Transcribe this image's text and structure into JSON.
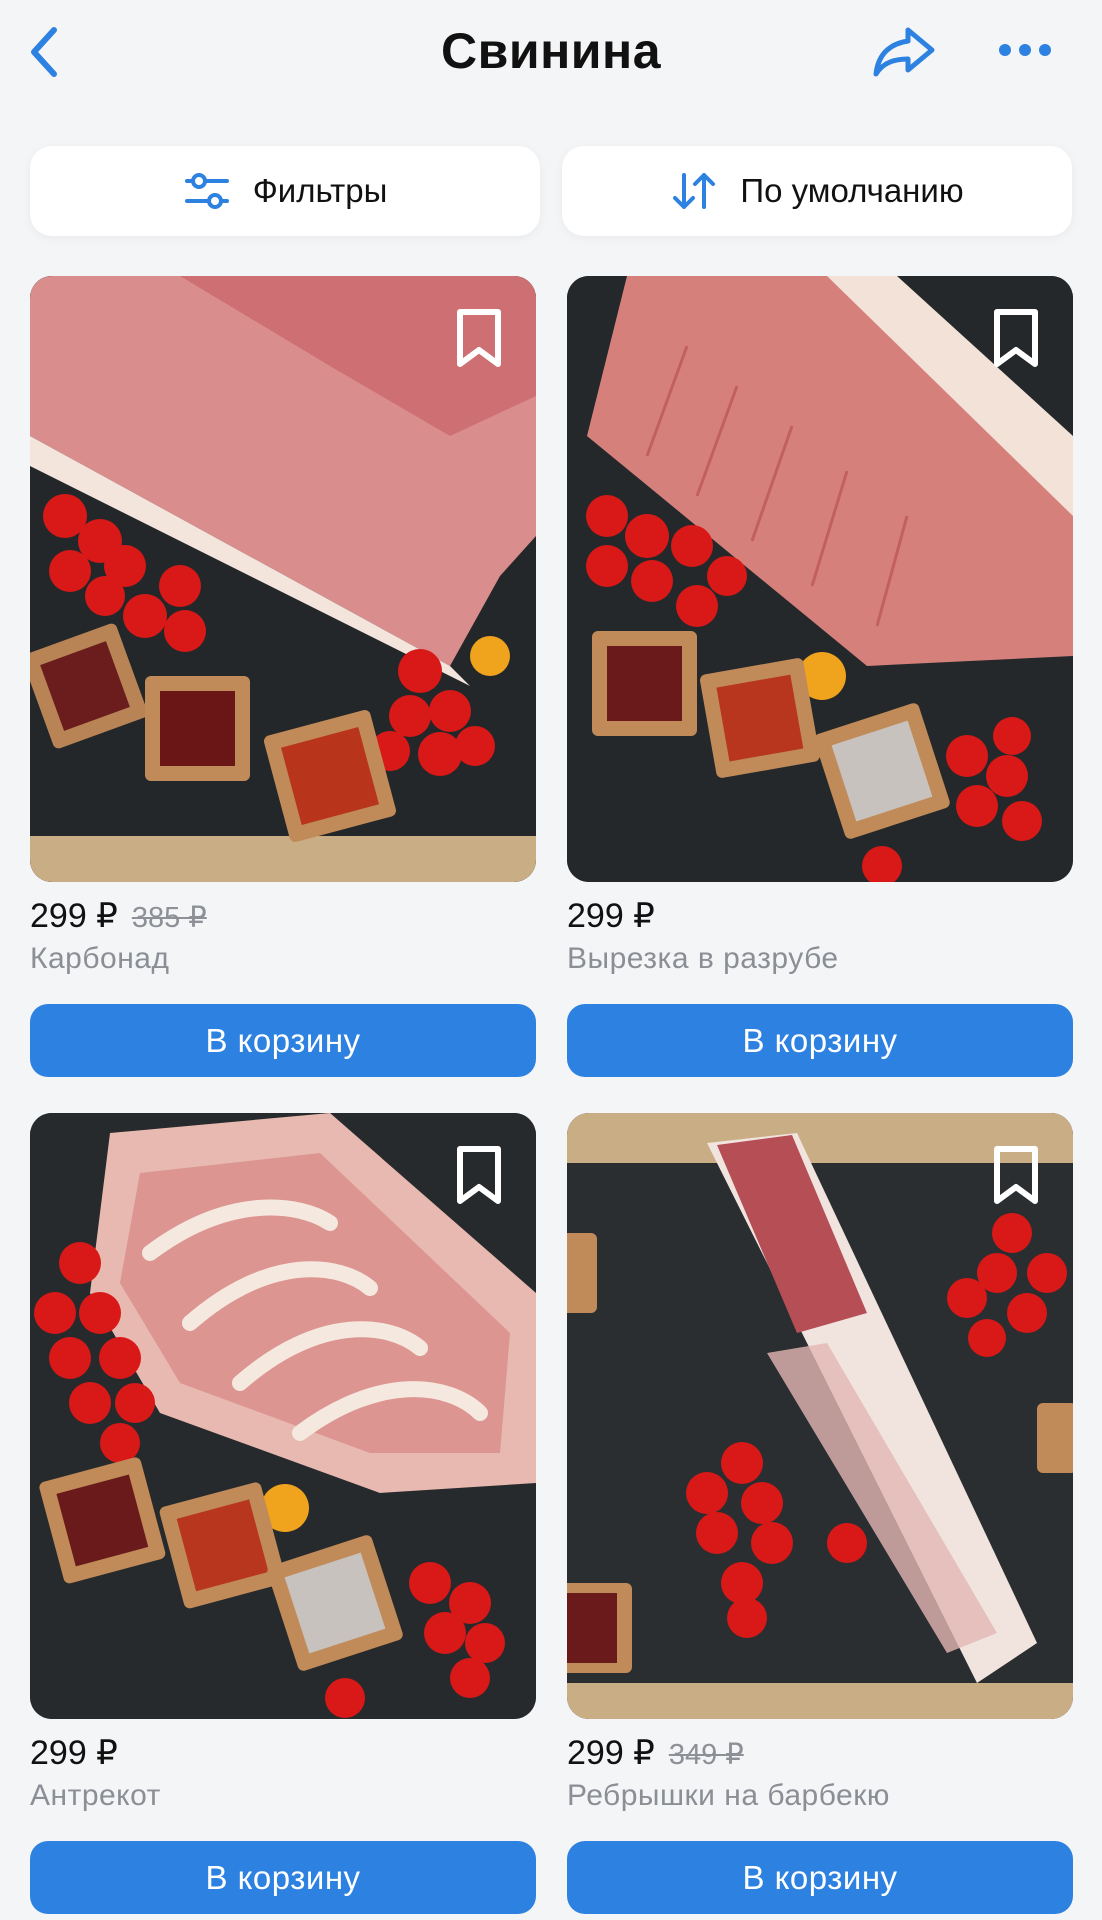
{
  "header": {
    "title": "Свинина",
    "back_icon": "chevron-left-icon",
    "share_icon": "share-arrow-icon",
    "more_icon": "more-dots-icon"
  },
  "toolbar": {
    "filters_label": "Фильтры",
    "filters_icon": "sliders-icon",
    "sort_label": "По умолчанию",
    "sort_icon": "sort-arrows-icon"
  },
  "colors": {
    "accent": "#2d81e0",
    "background": "#f4f5f7",
    "muted_text": "#8b8e94"
  },
  "products": [
    {
      "price": "299 ₽",
      "old_price": "385 ₽",
      "name": "Карбонад",
      "button_label": "В корзину",
      "image": "pork loin carbonade with tomatoes and spices"
    },
    {
      "price": "299 ₽",
      "old_price": "",
      "name": "Вырезка в разрубе",
      "button_label": "В корзину",
      "image": "sliced pork tenderloin with tomatoes and spices"
    },
    {
      "price": "299 ₽",
      "old_price": "",
      "name": "Антрекот",
      "button_label": "В корзину",
      "image": "pork entrecote cuts with tomatoes and spices"
    },
    {
      "price": "299 ₽",
      "old_price": "349 ₽",
      "name": "Ребрышки на барбекю",
      "button_label": "В корзину",
      "image": "pork ribs for barbecue with tomatoes"
    }
  ]
}
